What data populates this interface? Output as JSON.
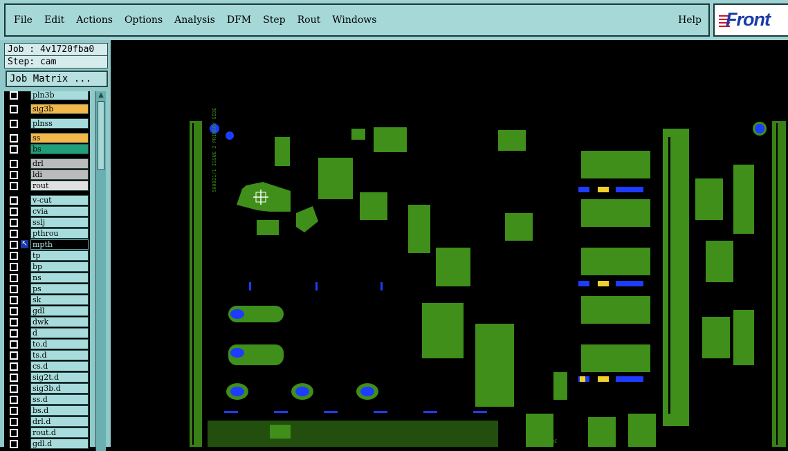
{
  "menu": {
    "items": [
      "File",
      "Edit",
      "Actions",
      "Options",
      "Analysis",
      "DFM",
      "Step",
      "Rout",
      "Windows"
    ],
    "help": "Help"
  },
  "logo": {
    "text": "Front"
  },
  "info": {
    "job": "Job : 4v1720fba0",
    "step": "Step: cam"
  },
  "job_matrix_label": "Job Matrix ...",
  "layers": [
    {
      "name": "pln3b",
      "style": "plain"
    },
    {
      "name": "sig3b",
      "style": "orange"
    },
    {
      "name": "plnss",
      "style": "plain"
    },
    {
      "name": "ss",
      "style": "orange"
    },
    {
      "name": "bs",
      "style": "teal"
    },
    {
      "name": "drl",
      "style": "grey"
    },
    {
      "name": "ldi",
      "style": "grey"
    },
    {
      "name": "rout",
      "style": "light"
    },
    {
      "name": "v-cut",
      "style": "plain"
    },
    {
      "name": "cvia",
      "style": "plain"
    },
    {
      "name": "sslj",
      "style": "plain"
    },
    {
      "name": "pthrou",
      "style": "plain"
    },
    {
      "name": "mpth",
      "style": "mpth"
    },
    {
      "name": "tp",
      "style": "plain"
    },
    {
      "name": "bp",
      "style": "plain"
    },
    {
      "name": "ns",
      "style": "plain"
    },
    {
      "name": "ps",
      "style": "plain"
    },
    {
      "name": "sk",
      "style": "plain"
    },
    {
      "name": "gdl",
      "style": "plain"
    },
    {
      "name": "dwk",
      "style": "plain"
    },
    {
      "name": "d",
      "style": "plain"
    },
    {
      "name": "to.d",
      "style": "plain"
    },
    {
      "name": "ts.d",
      "style": "plain"
    },
    {
      "name": "cs.d",
      "style": "plain"
    },
    {
      "name": "sig2t.d",
      "style": "plain"
    },
    {
      "name": "sig3b.d",
      "style": "plain"
    },
    {
      "name": "ss.d",
      "style": "plain"
    },
    {
      "name": "bs.d",
      "style": "plain"
    },
    {
      "name": "drl.d",
      "style": "plain"
    },
    {
      "name": "rout.d",
      "style": "plain"
    },
    {
      "name": "gdl.d",
      "style": "plain"
    }
  ],
  "board": {
    "silkscreen_vertical": "500821/1 ISSUE 2  PRIMARY SIDE",
    "silkscreen_bottom": "PRIMARY SIDE",
    "colors": {
      "copper": "#3f8f1a",
      "pad": "#1e3cff",
      "highlight": "#f2d02a"
    }
  }
}
